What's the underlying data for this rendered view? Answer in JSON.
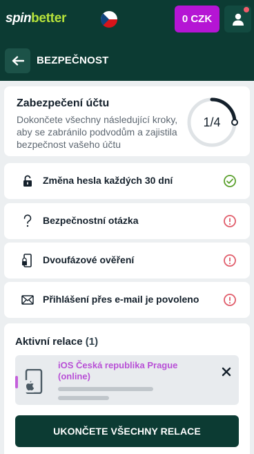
{
  "header": {
    "logo_spin": "spin",
    "logo_better": "better",
    "balance": "0 CZK",
    "language_flag": "cz-flag-icon"
  },
  "subheader": {
    "title": "BEZPEČNOST"
  },
  "security_score": {
    "title": "Zabezpečení účtu",
    "description": "Dokončete všechny následující kroky, aby se zabránilo podvodům a zajistila bezpečnost vašeho účtu",
    "progress_label": "1/4",
    "progress_fraction": 0.25
  },
  "items": [
    {
      "label": "Změna hesla každých 30 dní",
      "icon": "lock-icon",
      "status": "ok"
    },
    {
      "label": "Bezpečnostní otázka",
      "icon": "question-icon",
      "status": "warning"
    },
    {
      "label": "Dvoufázové ověření",
      "icon": "phone-lock-icon",
      "status": "warning"
    },
    {
      "label": "Přihlášení přes e-mail je povoleno",
      "icon": "envelope-icon",
      "status": "warning"
    }
  ],
  "sessions": {
    "title": "Aktivní relace",
    "count": "(1)",
    "list": [
      {
        "name": "iOS Česká republika Prague (online)"
      }
    ],
    "end_all_label": "UKONČETE VŠECHNY RELACE"
  },
  "colors": {
    "header_bg": "#0c3b33",
    "balance_bg": "#b515d4",
    "status_ok": "#5aa02c",
    "status_warning": "#e05a68",
    "session_accent": "#c45fdb"
  }
}
